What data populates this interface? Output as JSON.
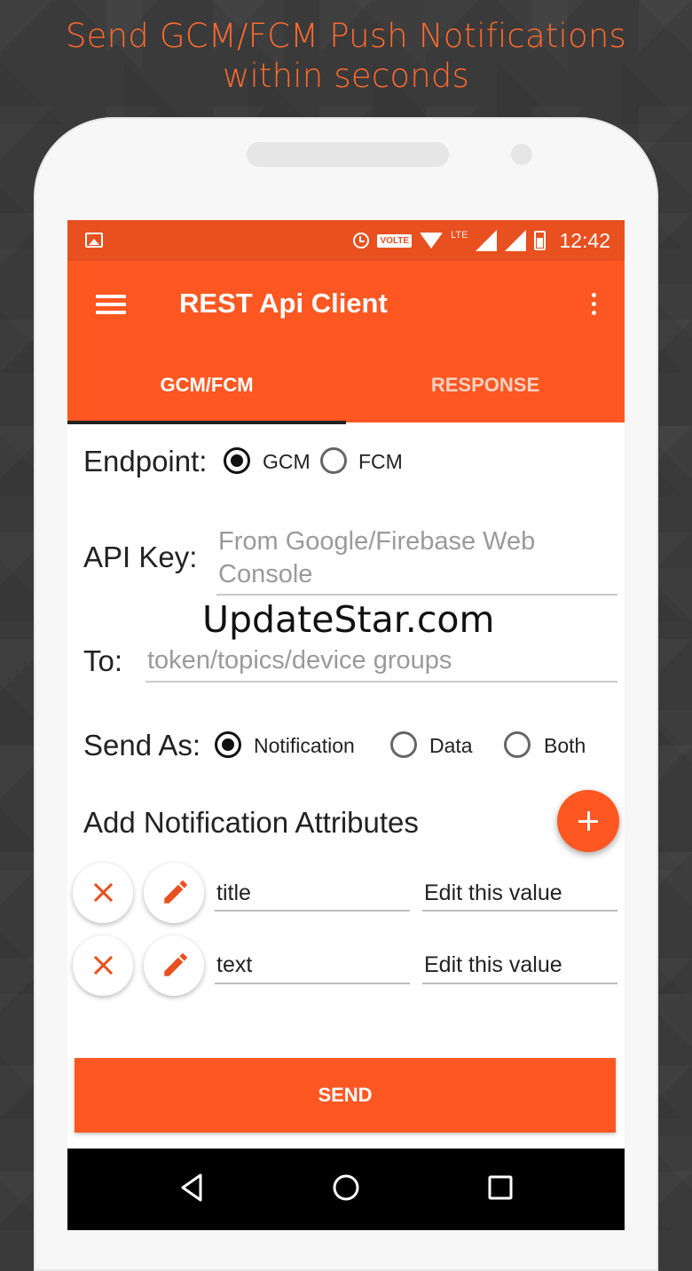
{
  "promo": {
    "headline_line1": "Send GCM/FCM Push Notifications",
    "headline_line2": "within seconds"
  },
  "statusbar": {
    "volte": "VOLTE",
    "lte": "LTE",
    "time": "12:42"
  },
  "appbar": {
    "title": "REST Api Client"
  },
  "tabs": [
    {
      "label": "GCM/FCM",
      "active": true
    },
    {
      "label": "RESPONSE",
      "active": false
    }
  ],
  "form": {
    "endpoint_label": "Endpoint:",
    "endpoint_options": [
      {
        "label": "GCM",
        "checked": true
      },
      {
        "label": "FCM",
        "checked": false
      }
    ],
    "api_key_label": "API Key:",
    "api_key_placeholder_line1": "From Google/Firebase Web",
    "api_key_placeholder_line2": "Console",
    "to_label": "To:",
    "to_placeholder": "token/topics/device groups",
    "send_as_label": "Send As:",
    "send_as_options": [
      {
        "label": "Notification",
        "checked": true
      },
      {
        "label": "Data",
        "checked": false
      },
      {
        "label": "Both",
        "checked": false
      }
    ],
    "attributes_title": "Add Notification Attributes",
    "attributes": [
      {
        "key": "title",
        "value": "Edit this value"
      },
      {
        "key": "text",
        "value": "Edit this value"
      }
    ],
    "send_label": "SEND"
  },
  "watermark": "UpdateStar.com",
  "colors": {
    "accent": "#fe5722",
    "statusbar": "#e8501f",
    "headline": "#ff6a2e"
  }
}
